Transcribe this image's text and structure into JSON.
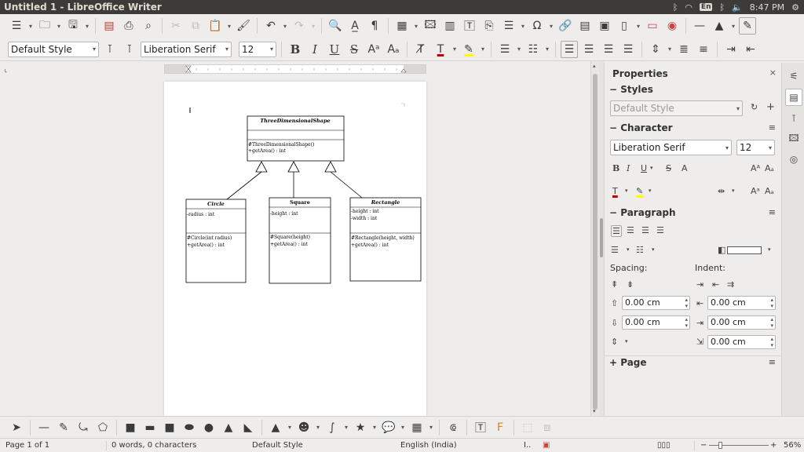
{
  "window": {
    "title": "Untitled 1 - LibreOffice Writer",
    "tray": {
      "keyboard": "En",
      "clock": "8:47 PM"
    }
  },
  "format_bar": {
    "paragraph_style": "Default Style",
    "font_name": "Liberation Serif",
    "font_size": "12"
  },
  "document": {
    "diagram": {
      "base": {
        "name": "ThreeDimensionalShape",
        "methods": [
          "#ThreeDimensionalShape()",
          "+getArea() : int"
        ]
      },
      "classes": [
        {
          "name": "Circle",
          "attributes": [
            "-radius : int"
          ],
          "methods": [
            "#Circle(int radius)",
            "+getArea() : int"
          ]
        },
        {
          "name": "Square",
          "attributes": [
            "-height : int"
          ],
          "methods": [
            "#Square(height)",
            "+getArea() : int"
          ]
        },
        {
          "name": "Rectangle",
          "attributes": [
            "-height : int",
            "-width : int"
          ],
          "methods": [
            "#Rectangle(height, width)",
            "+getArea() : int"
          ]
        }
      ]
    }
  },
  "sidebar": {
    "title": "Properties",
    "styles": {
      "header": "Styles",
      "value": "Default Style"
    },
    "character": {
      "header": "Character",
      "font_name": "Liberation Serif",
      "font_size": "12"
    },
    "paragraph": {
      "header": "Paragraph",
      "spacing_label": "Spacing:",
      "indent_label": "Indent:",
      "above": "0.00 cm",
      "below": "0.00 cm",
      "before": "0.00 cm",
      "after": "0.00 cm",
      "first_line": "0.00 cm"
    },
    "page": {
      "header": "Page"
    }
  },
  "status": {
    "page": "Page 1 of 1",
    "words": "0 words, 0 characters",
    "style": "Default Style",
    "language": "English (India)",
    "zoom": "56%"
  },
  "colors": {
    "titlebar": "#3c3b37",
    "font_color": "#c00000",
    "highlight": "#ffff00"
  }
}
